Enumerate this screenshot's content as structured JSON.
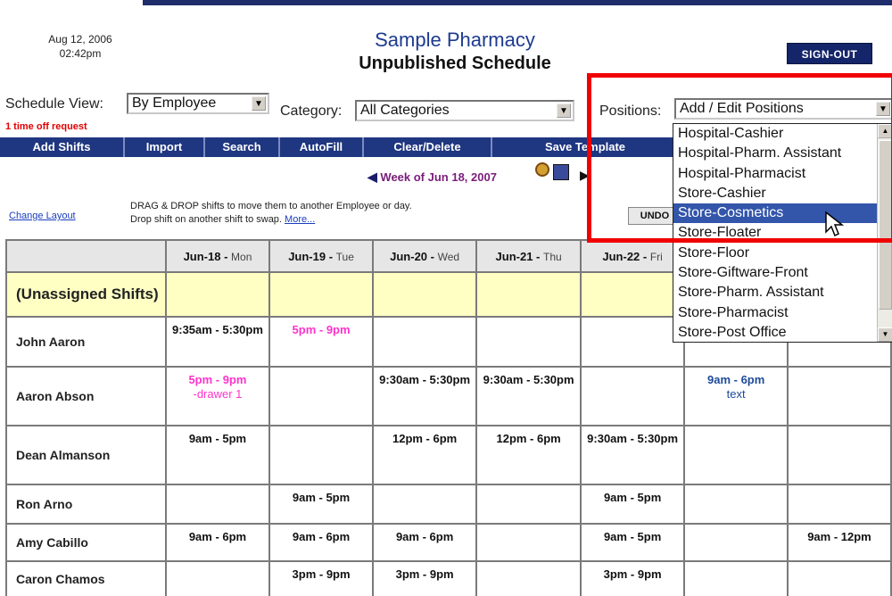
{
  "header": {
    "date": "Aug 12, 2006",
    "time": "02:42pm",
    "title": "Sample Pharmacy",
    "subtitle": "Unpublished Schedule",
    "signout_label": "SIGN-OUT"
  },
  "controls": {
    "schedule_view_label": "Schedule View:",
    "schedule_view_value": "By Employee",
    "time_off": "1 time off request",
    "category_label": "Category:",
    "category_value": "All Categories",
    "positions_label": "Positions:",
    "positions_value": "Add / Edit Positions"
  },
  "toolbar": {
    "add_shifts": "Add Shifts",
    "import": "Import",
    "search": "Search",
    "autofill": "AutoFill",
    "clear_delete": "Clear/Delete",
    "save_template": "Save Template"
  },
  "week": {
    "label": "Week of Jun 18, 2007"
  },
  "layout": {
    "change_layout": "Change Layout",
    "help_line1": "DRAG & DROP shifts to move them to another Employee or day.",
    "help_line2": "Drop shift on another shift to swap.",
    "more": "More...",
    "undo": "UNDO"
  },
  "grid": {
    "columns": [
      {
        "date": "Jun-18",
        "day": "Mon"
      },
      {
        "date": "Jun-19",
        "day": "Tue"
      },
      {
        "date": "Jun-20",
        "day": "Wed"
      },
      {
        "date": "Jun-21",
        "day": "Thu"
      },
      {
        "date": "Jun-22",
        "day": "Fri"
      }
    ],
    "unassigned_label": "(Unassigned Shifts)",
    "rows": [
      {
        "name": "John Aaron",
        "mon": "9:35am - 5:30pm",
        "tue": "5pm - 9pm",
        "wed": "",
        "thu": "",
        "fri": "",
        "sat": "",
        "sun": ""
      },
      {
        "name": "Aaron Abson",
        "mon": "5pm - 9pm",
        "mon_note": "-drawer 1",
        "tue": "",
        "wed": "9:30am - 5:30pm",
        "thu": "9:30am - 5:30pm",
        "fri": "",
        "sat": "9am - 6pm",
        "sat_note": "text",
        "sun": ""
      },
      {
        "name": "Dean Almanson",
        "mon": "9am - 5pm",
        "tue": "",
        "wed": "12pm - 6pm",
        "thu": "12pm - 6pm",
        "fri": "9:30am - 5:30pm",
        "sat": "",
        "sun": ""
      },
      {
        "name": "Ron Arno",
        "mon": "",
        "tue": "9am - 5pm",
        "wed": "",
        "thu": "",
        "fri": "9am - 5pm",
        "sat": "",
        "sun": ""
      },
      {
        "name": "Amy Cabillo",
        "mon": "9am - 6pm",
        "tue": "9am - 6pm",
        "wed": "9am - 6pm",
        "thu": "",
        "fri": "9am - 5pm",
        "sat": "",
        "sun": "9am - 12pm"
      },
      {
        "name": "Caron Chamos",
        "mon": "",
        "tue": "3pm - 9pm",
        "wed": "3pm - 9pm",
        "thu": "",
        "fri": "3pm - 9pm",
        "sat": "",
        "sun": ""
      }
    ]
  },
  "positions_dropdown": {
    "options": [
      "Hospital-Cashier",
      "Hospital-Pharm. Assistant",
      "Hospital-Pharmacist",
      "Store-Cashier",
      "Store-Cosmetics",
      "Store-Floater",
      "Store-Floor",
      "Store-Giftware-Front",
      "Store-Pharm. Assistant",
      "Store-Pharmacist",
      "Store-Post Office"
    ],
    "selected": "Store-Cosmetics"
  },
  "colors": {
    "toolbar": "#1f3680",
    "highlight_box": "#f00000",
    "unassigned_bg": "#ffffc4",
    "pink_shift": "#ff33cc",
    "selected_option": "#3355aa"
  }
}
